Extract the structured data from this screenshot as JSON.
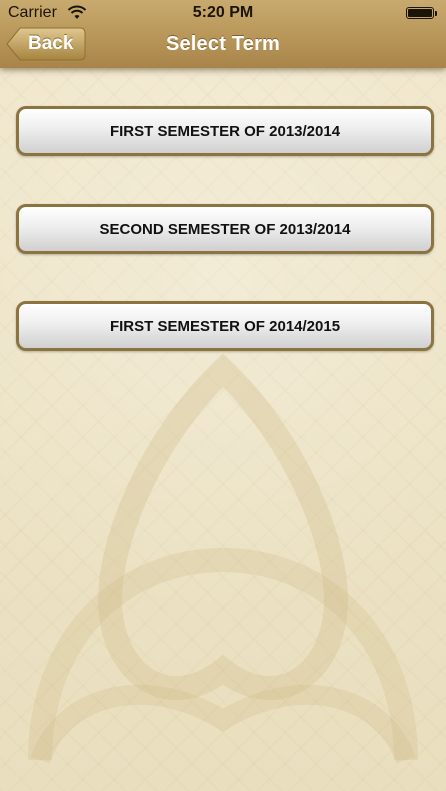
{
  "status_bar": {
    "carrier": "Carrier",
    "time": "5:20 PM"
  },
  "nav": {
    "back_label": "Back",
    "title": "Select Term"
  },
  "terms": [
    {
      "label": "FIRST SEMESTER OF 2013/2014"
    },
    {
      "label": "SECOND SEMESTER OF 2013/2014"
    },
    {
      "label": "FIRST SEMESTER OF 2014/2015"
    }
  ],
  "colors": {
    "header_gold": "#b8965a",
    "button_border": "#8c7441",
    "background": "#efe6c9"
  }
}
